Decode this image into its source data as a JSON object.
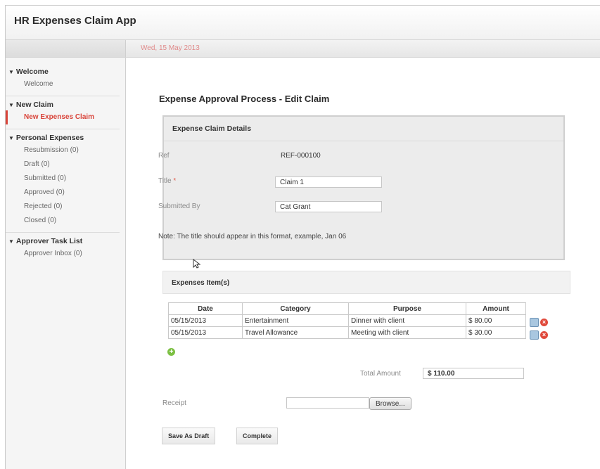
{
  "app": {
    "title": "HR Expenses Claim App",
    "date": "Wed, 15 May 2013"
  },
  "sidebar": {
    "groups": [
      {
        "label": "Welcome",
        "items": [
          {
            "label": "Welcome"
          }
        ]
      },
      {
        "label": "New Claim",
        "items": [
          {
            "label": "New Expenses Claim",
            "active": true
          }
        ]
      },
      {
        "label": "Personal Expenses",
        "items": [
          {
            "label": "Resubmission (0)"
          },
          {
            "label": "Draft (0)"
          },
          {
            "label": "Submitted (0)"
          },
          {
            "label": "Approved (0)"
          },
          {
            "label": "Rejected (0)"
          },
          {
            "label": "Closed (0)"
          }
        ]
      },
      {
        "label": "Approver Task List",
        "items": [
          {
            "label": "Approver Inbox (0)"
          }
        ]
      }
    ]
  },
  "main": {
    "page_title": "Expense Approval Process - Edit Claim",
    "details": {
      "title": "Expense Claim Details",
      "ref_label": "Ref",
      "ref_value": "REF-000100",
      "title_label": "Title",
      "required_mark": "*",
      "title_value": "Claim 1",
      "submitted_by_label": "Submitted By",
      "submitted_by_value": "Cat Grant",
      "note": "Note: The title should appear in this format, example, Jan 06"
    },
    "items": {
      "title": "Expenses Item(s)",
      "columns": [
        "Date",
        "Category",
        "Purpose",
        "Amount"
      ],
      "rows": [
        {
          "date": "05/15/2013",
          "category": "Entertainment",
          "purpose": "Dinner with client",
          "amount": "$ 80.00"
        },
        {
          "date": "05/15/2013",
          "category": "Travel Allowance",
          "purpose": "Meeting with client",
          "amount": "$ 30.00"
        }
      ],
      "add_icon": "+",
      "delete_icon": "×"
    },
    "total_label": "Total Amount",
    "total_value": "$ 110.00",
    "receipt_label": "Receipt",
    "browse_label": "Browse...",
    "save_draft_label": "Save As Draft",
    "complete_label": "Complete"
  }
}
